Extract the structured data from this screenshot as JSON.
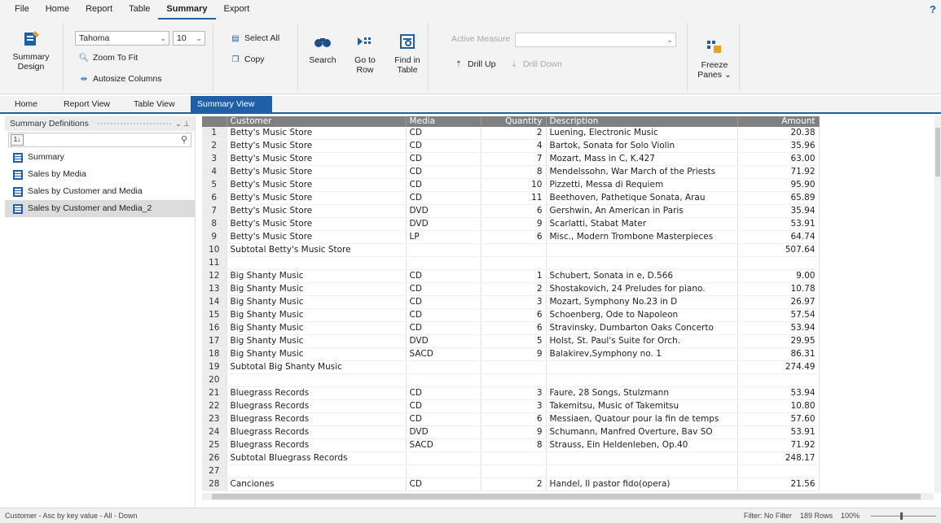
{
  "menubar": {
    "items": [
      "File",
      "Home",
      "Report",
      "Table",
      "Summary",
      "Export"
    ],
    "active_index": 4,
    "help": "?"
  },
  "ribbon": {
    "summary_design": "Summary\nDesign",
    "font_name": "Tahoma",
    "font_size": "10",
    "zoom_to_fit": "Zoom To Fit",
    "autosize_columns": "Autosize Columns",
    "select_all": "Select All",
    "copy": "Copy",
    "search": "Search",
    "go_to_row": "Go to\nRow",
    "find_in_table": "Find in\nTable",
    "active_measure_label": "Active Measure",
    "active_measure_value": "",
    "drill_up": "Drill Up",
    "drill_down": "Drill Down",
    "freeze_panes": "Freeze\nPanes ⌄"
  },
  "tabs": [
    "Home",
    "Report View",
    "Table View",
    "Summary View"
  ],
  "active_tab": "Summary View",
  "sidepanel": {
    "title": "Summary Definitions",
    "sort_label": "1↓",
    "items": [
      "Summary",
      "Sales by Media",
      "Sales by Customer and Media",
      "Sales by Customer and Media_2"
    ],
    "selected_index": 3
  },
  "grid": {
    "columns": [
      "Customer",
      "Media",
      "Quantity",
      "Description",
      "Amount"
    ],
    "rows": [
      {
        "n": "1",
        "customer": "Betty's Music Store",
        "media": "CD",
        "qty": "2",
        "desc": "Luening, Electronic Music",
        "amount": "20.38"
      },
      {
        "n": "2",
        "customer": "Betty's Music Store",
        "media": "CD",
        "qty": "4",
        "desc": "Bartok, Sonata for Solo Violin",
        "amount": "35.96"
      },
      {
        "n": "3",
        "customer": "Betty's Music Store",
        "media": "CD",
        "qty": "7",
        "desc": "Mozart, Mass in C, K.427",
        "amount": "63.00"
      },
      {
        "n": "4",
        "customer": "Betty's Music Store",
        "media": "CD",
        "qty": "8",
        "desc": "Mendelssohn, War March of the Priests",
        "amount": "71.92"
      },
      {
        "n": "5",
        "customer": "Betty's Music Store",
        "media": "CD",
        "qty": "10",
        "desc": "Pizzetti, Messa di Requiem",
        "amount": "95.90"
      },
      {
        "n": "6",
        "customer": "Betty's Music Store",
        "media": "CD",
        "qty": "11",
        "desc": "Beethoven, Pathetique Sonata, Arau",
        "amount": "65.89"
      },
      {
        "n": "7",
        "customer": "Betty's Music Store",
        "media": "DVD",
        "qty": "6",
        "desc": "Gershwin, An American in Paris",
        "amount": "35.94"
      },
      {
        "n": "8",
        "customer": "Betty's Music Store",
        "media": "DVD",
        "qty": "9",
        "desc": "Scarlatti, Stabat Mater",
        "amount": "53.91"
      },
      {
        "n": "9",
        "customer": "Betty's Music Store",
        "media": "LP",
        "qty": "6",
        "desc": "Misc., Modern Trombone Masterpieces",
        "amount": "64.74"
      },
      {
        "n": "10",
        "customer": "Subtotal Betty's Music Store",
        "media": "",
        "qty": "",
        "desc": "",
        "amount": "507.64",
        "subtotal": true
      },
      {
        "n": "11",
        "customer": "",
        "media": "",
        "qty": "",
        "desc": "",
        "amount": ""
      },
      {
        "n": "12",
        "customer": "Big Shanty Music",
        "media": "CD",
        "qty": "1",
        "desc": "Schubert, Sonata in e, D.566",
        "amount": "9.00"
      },
      {
        "n": "13",
        "customer": "Big Shanty Music",
        "media": "CD",
        "qty": "2",
        "desc": "Shostakovich, 24 Preludes for piano.",
        "amount": "10.78"
      },
      {
        "n": "14",
        "customer": "Big Shanty Music",
        "media": "CD",
        "qty": "3",
        "desc": "Mozart, Symphony No.23 in D",
        "amount": "26.97"
      },
      {
        "n": "15",
        "customer": "Big Shanty Music",
        "media": "CD",
        "qty": "6",
        "desc": "Schoenberg, Ode to Napoleon",
        "amount": "57.54"
      },
      {
        "n": "16",
        "customer": "Big Shanty Music",
        "media": "CD",
        "qty": "6",
        "desc": "Stravinsky, Dumbarton Oaks Concerto",
        "amount": "53.94"
      },
      {
        "n": "17",
        "customer": "Big Shanty Music",
        "media": "DVD",
        "qty": "5",
        "desc": "Holst, St. Paul's Suite for Orch.",
        "amount": "29.95"
      },
      {
        "n": "18",
        "customer": "Big Shanty Music",
        "media": "SACD",
        "qty": "9",
        "desc": "Balakirev,Symphony no. 1",
        "amount": "86.31"
      },
      {
        "n": "19",
        "customer": "Subtotal Big Shanty Music",
        "media": "",
        "qty": "",
        "desc": "",
        "amount": "274.49",
        "subtotal": true
      },
      {
        "n": "20",
        "customer": "",
        "media": "",
        "qty": "",
        "desc": "",
        "amount": ""
      },
      {
        "n": "21",
        "customer": "Bluegrass Records",
        "media": "CD",
        "qty": "3",
        "desc": "Faure, 28 Songs, Stulzmann",
        "amount": "53.94"
      },
      {
        "n": "22",
        "customer": "Bluegrass Records",
        "media": "CD",
        "qty": "3",
        "desc": "Takemitsu, Music of Takemitsu",
        "amount": "10.80"
      },
      {
        "n": "23",
        "customer": "Bluegrass Records",
        "media": "CD",
        "qty": "6",
        "desc": "Messiaen, Quatour pour la fin de temps",
        "amount": "57.60"
      },
      {
        "n": "24",
        "customer": "Bluegrass Records",
        "media": "DVD",
        "qty": "9",
        "desc": "Schumann, Manfred Overture, Bav SO",
        "amount": "53.91"
      },
      {
        "n": "25",
        "customer": "Bluegrass Records",
        "media": "SACD",
        "qty": "8",
        "desc": "Strauss, Ein Heldenleben, Op.40",
        "amount": "71.92"
      },
      {
        "n": "26",
        "customer": "Subtotal Bluegrass Records",
        "media": "",
        "qty": "",
        "desc": "",
        "amount": "248.17",
        "subtotal": true
      },
      {
        "n": "27",
        "customer": "",
        "media": "",
        "qty": "",
        "desc": "",
        "amount": ""
      },
      {
        "n": "28",
        "customer": "Canciones",
        "media": "CD",
        "qty": "2",
        "desc": "Handel, Il pastor fido(opera)",
        "amount": "21.56"
      }
    ]
  },
  "status": {
    "left": "Customer - Asc by key value - All - Down",
    "filter": "Filter: No Filter",
    "rows": "189 Rows",
    "zoom": "100%"
  },
  "colors": {
    "accent": "#1f5fa8",
    "header_bg": "#808080"
  }
}
